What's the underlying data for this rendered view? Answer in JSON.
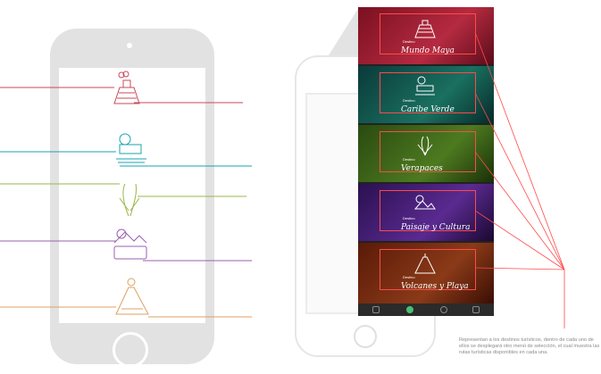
{
  "colors": {
    "mundo_maya": "#c94a5a",
    "caribe_verde": "#1aa3b3",
    "verapaces": "#9ab64a",
    "paisaje_cultura": "#9a5fb0",
    "volcanes_playa": "#e0a060",
    "callout_red": "#ff4a4a"
  },
  "destinos": [
    {
      "small": "Destino",
      "name": "Mundo Maya",
      "icon": "pyramid-icon"
    },
    {
      "small": "Destino",
      "name": "Caribe Verde",
      "icon": "boat-icon"
    },
    {
      "small": "Destino",
      "name": "Verapaces",
      "icon": "flower-icon"
    },
    {
      "small": "Destino",
      "name": "Paisaje y Cultura",
      "icon": "landscape-icon"
    },
    {
      "small": "Destino",
      "name": "Volcanes y Playa",
      "icon": "volcano-icon"
    }
  ],
  "nav_icons": [
    "user-icon",
    "globe-icon",
    "heart-icon",
    "chat-icon"
  ],
  "caption": "Representan a los destinos turísticos, dentro de cada uno de ellos se desplegará otro menú de selección, el cual muestra las rutas turísticas disponibles en cada una."
}
